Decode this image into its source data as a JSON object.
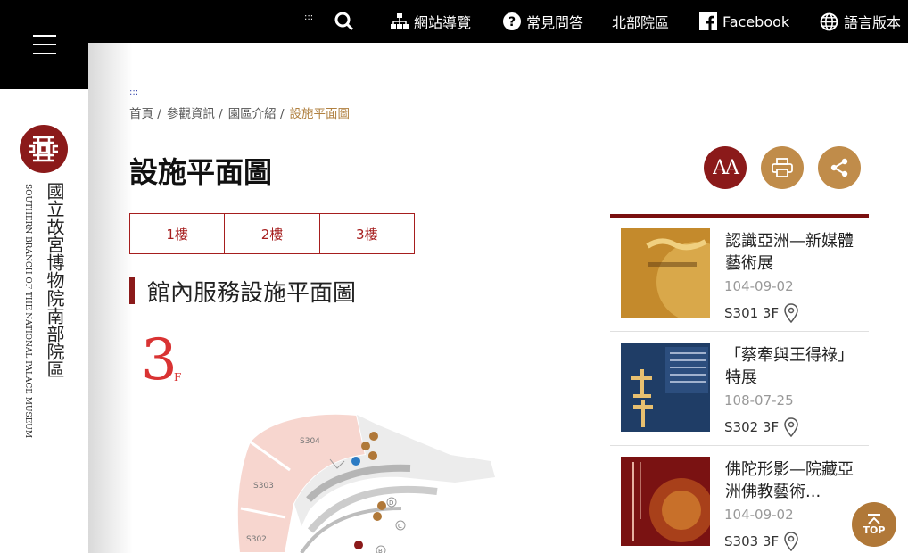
{
  "topbar": {
    "accesskey": ":::",
    "nav": [
      {
        "label": "網站導覽",
        "icon": "sitemap-icon"
      },
      {
        "label": "常見問答",
        "icon": "question-icon"
      },
      {
        "label": "北部院區",
        "icon": ""
      },
      {
        "label": "Facebook",
        "icon": "facebook-icon"
      },
      {
        "label": "語言版本",
        "icon": "globe-icon"
      }
    ]
  },
  "logo": {
    "name_cn": "國立故宮博物院南部院區",
    "name_en": "SOUTHERN BRANCH OF THE NATIONAL PALACE MUSEUM"
  },
  "content": {
    "accesskey": ":::",
    "breadcrumb": [
      "首頁 /",
      "參觀資訊 /",
      "園區介紹 /",
      "設施平面圖"
    ],
    "title": "設施平面圖",
    "font_button": "AA",
    "floors": [
      "1樓",
      "2樓",
      "3樓"
    ],
    "section_title": "館內服務設施平面圖",
    "floor_number": "3",
    "floor_suffix": "F",
    "map_labels": [
      "S304",
      "S303",
      "S302",
      "D",
      "C",
      "B"
    ]
  },
  "exhibitions": [
    {
      "title": "認識亞洲—新媒體藝術展",
      "date": "104-09-02",
      "location": "S301 3F"
    },
    {
      "title": "「蔡牽與王得祿」特展",
      "date": "108-07-25",
      "location": "S302 3F"
    },
    {
      "title": "佛陀形影—院藏亞洲佛教藝術...",
      "date": "104-09-02",
      "location": "S303 3F"
    }
  ],
  "top_button": "TOP",
  "colors": {
    "brand_red": "#8b1a1a",
    "gold": "#c08c4a",
    "topbar": "#000000"
  }
}
